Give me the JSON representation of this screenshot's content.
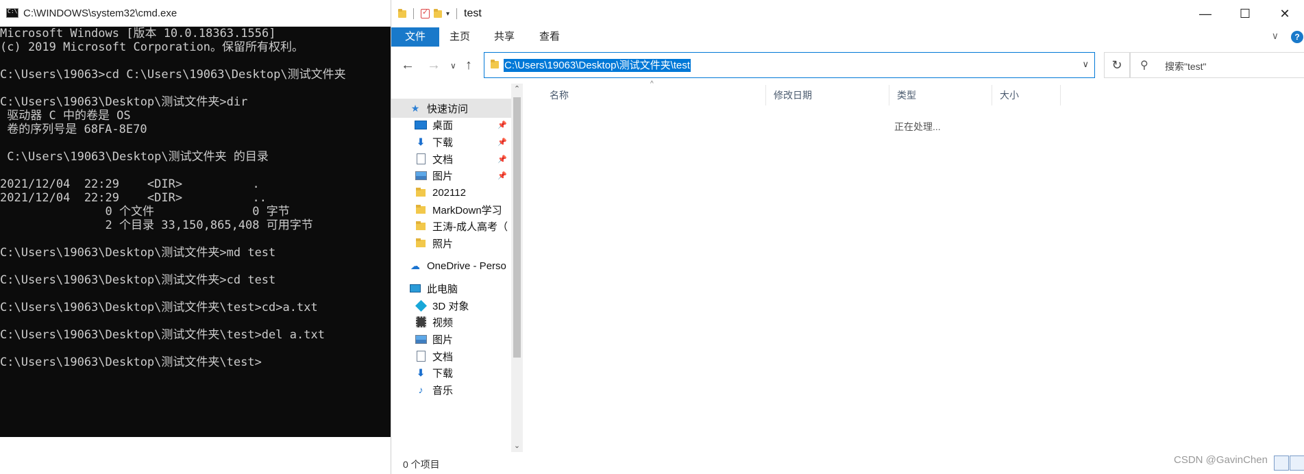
{
  "cmd": {
    "title": "C:\\WINDOWS\\system32\\cmd.exe",
    "lines": [
      "Microsoft Windows [版本 10.0.18363.1556]",
      "(c) 2019 Microsoft Corporation。保留所有权利。",
      "",
      "C:\\Users\\19063>cd C:\\Users\\19063\\Desktop\\测试文件夹",
      "",
      "C:\\Users\\19063\\Desktop\\测试文件夹>dir",
      " 驱动器 C 中的卷是 OS",
      " 卷的序列号是 68FA-8E70",
      "",
      " C:\\Users\\19063\\Desktop\\测试文件夹 的目录",
      "",
      "2021/12/04  22:29    <DIR>          .",
      "2021/12/04  22:29    <DIR>          ..",
      "               0 个文件              0 字节",
      "               2 个目录 33,150,865,408 可用字节",
      "",
      "C:\\Users\\19063\\Desktop\\测试文件夹>md test",
      "",
      "C:\\Users\\19063\\Desktop\\测试文件夹>cd test",
      "",
      "C:\\Users\\19063\\Desktop\\测试文件夹\\test>cd>a.txt",
      "",
      "C:\\Users\\19063\\Desktop\\测试文件夹\\test>del a.txt",
      "",
      "C:\\Users\\19063\\Desktop\\测试文件夹\\test>"
    ]
  },
  "explorer": {
    "title": "test",
    "ribbon_tabs": [
      "文件",
      "主页",
      "共享",
      "查看"
    ],
    "address_path": "C:\\Users\\19063\\Desktop\\测试文件夹\\test",
    "search_placeholder": "搜索\"test\"",
    "nav": {
      "quick_access": "快速访问",
      "desktop": "桌面",
      "downloads": "下载",
      "documents": "文档",
      "pictures": "图片",
      "folder1": "202112",
      "folder2": "MarkDown学习",
      "folder3": "王涛-成人高考（",
      "folder4": "照片",
      "onedrive": "OneDrive - Perso",
      "this_pc": "此电脑",
      "objects3d": "3D 对象",
      "videos": "视频",
      "pc_pictures": "图片",
      "pc_documents": "文档",
      "pc_downloads": "下载",
      "music": "音乐"
    },
    "columns": [
      "名称",
      "修改日期",
      "类型",
      "大小"
    ],
    "processing_text": "正在处理...",
    "status_text": "0 个项目"
  },
  "watermark": "CSDN @GavinChen",
  "colors": {
    "accent": "#0078d7",
    "file_tab": "#1979ca",
    "terminal_bg": "#0c0c0c",
    "terminal_fg": "#cccccc"
  }
}
